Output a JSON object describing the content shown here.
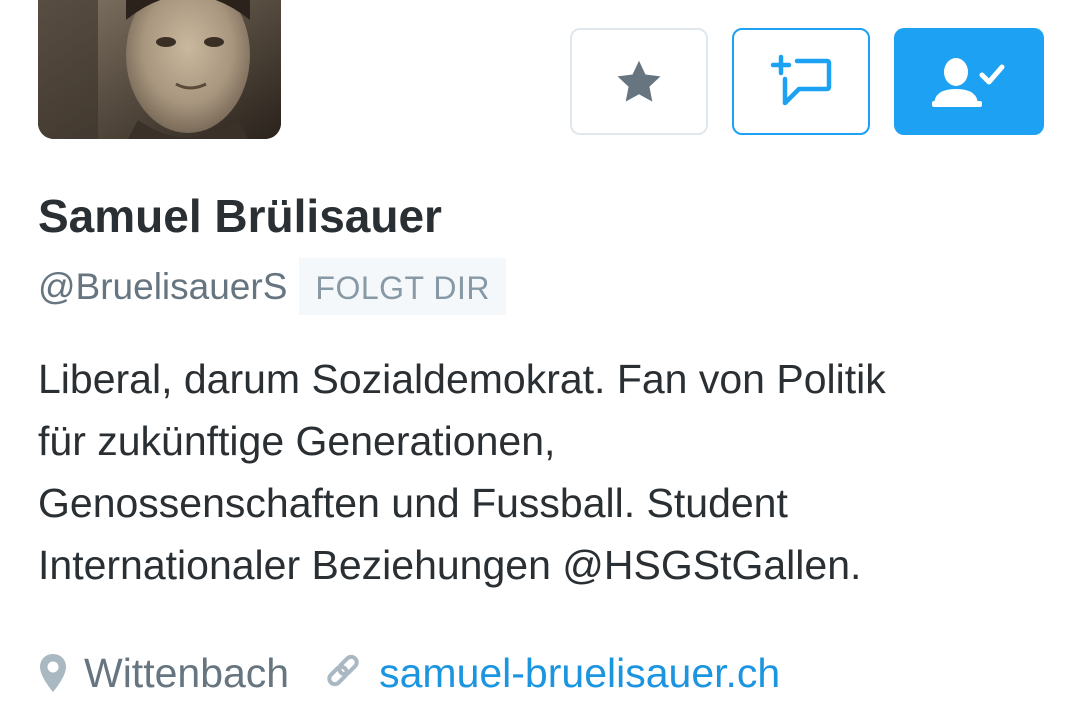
{
  "profile": {
    "name": "Samuel Brülisauer",
    "handle": "@BruelisauerS",
    "follows_you_badge": "FOLGT DIR",
    "bio_lines": [
      "Liberal, darum Sozialdemokrat. Fan von Politik",
      "für zukünftige Generationen,",
      "Genossenschaften und Fussball. Student",
      "Internationaler Beziehungen @HSGStGallen."
    ],
    "location": "Wittenbach",
    "website": "samuel-bruelisauer.ch"
  },
  "actions": {
    "star_icon": "star-icon",
    "dm_icon": "new-message-icon",
    "following_icon": "user-following-check-icon"
  },
  "colors": {
    "accent": "#1da1f2",
    "link": "#1b95e0",
    "text_primary": "#292f33",
    "text_secondary": "#66757f",
    "badge_bg": "#f5f8fa",
    "badge_text": "#8899a6",
    "star_icon": "#66757f",
    "meta_icon": "#aab8c2"
  }
}
